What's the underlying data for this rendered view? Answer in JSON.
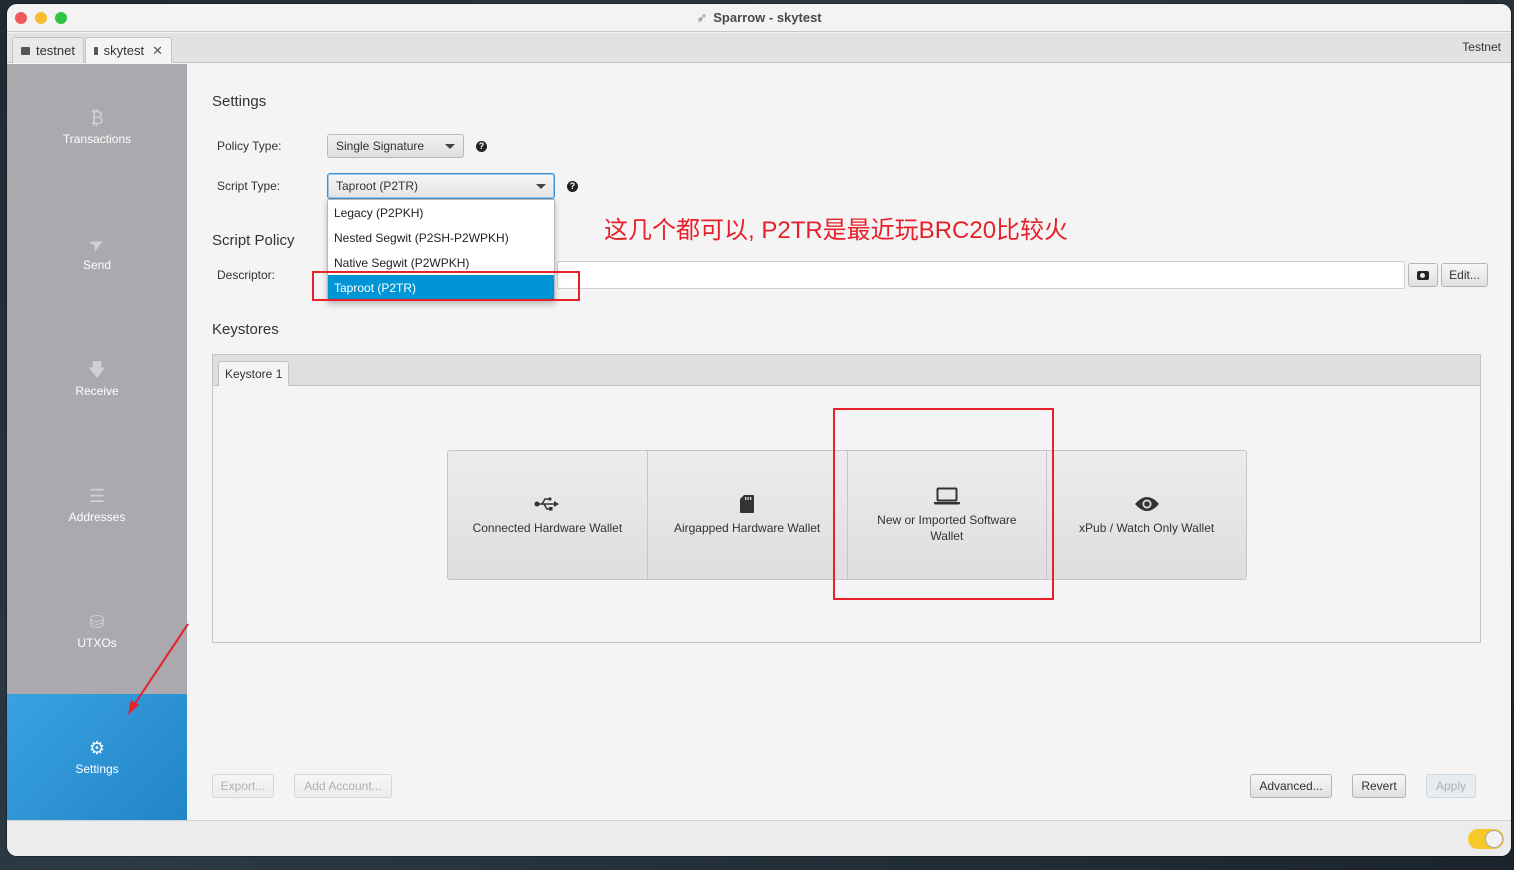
{
  "window": {
    "title": "Sparrow - skytest",
    "app_icon": "sparrow-bird-icon"
  },
  "tabs": [
    {
      "label": "testnet",
      "icon": "wallet-icon",
      "closable": false,
      "active": false
    },
    {
      "label": "skytest",
      "icon": "wallet-icon",
      "closable": true,
      "active": true,
      "close_glyph": "✕"
    }
  ],
  "network": "Testnet",
  "sidebar": {
    "items": [
      {
        "label": "Transactions",
        "icon": "bitcoin-icon",
        "glyph": "₿",
        "active": false
      },
      {
        "label": "Send",
        "icon": "paper-plane-icon",
        "glyph": "➤",
        "active": false
      },
      {
        "label": "Receive",
        "icon": "arrow-down-icon",
        "glyph": "🡇",
        "active": false
      },
      {
        "label": "Addresses",
        "icon": "list-icon",
        "glyph": "☰",
        "active": false
      },
      {
        "label": "UTXOs",
        "icon": "coins-icon",
        "glyph": "⛁",
        "active": false
      },
      {
        "label": "Settings",
        "icon": "gear-icon",
        "glyph": "⚙",
        "active": true
      }
    ]
  },
  "settings": {
    "title": "Settings",
    "policy_type": {
      "label": "Policy Type:",
      "value": "Single Signature"
    },
    "script_type": {
      "label": "Script Type:",
      "value": "Taproot (P2TR)",
      "options": [
        {
          "label": "Legacy (P2PKH)",
          "selected": false
        },
        {
          "label": "Nested Segwit (P2SH-P2WPKH)",
          "selected": false
        },
        {
          "label": "Native Segwit (P2WPKH)",
          "selected": false
        },
        {
          "label": "Taproot (P2TR)",
          "selected": true
        }
      ]
    },
    "help_glyph": "?"
  },
  "script_policy": {
    "title": "Script Policy",
    "descriptor_label": "Descriptor:",
    "descriptor_value": "",
    "edit_label": "Edit...",
    "camera_icon": "camera-icon"
  },
  "keystores": {
    "title": "Keystores",
    "tabs": [
      {
        "label": "Keystore 1"
      }
    ],
    "options": [
      {
        "label": "Connected Hardware Wallet",
        "icon": "usb-icon"
      },
      {
        "label": "Airgapped Hardware Wallet",
        "icon": "sd-card-icon"
      },
      {
        "label": "New or Imported Software Wallet",
        "icon": "laptop-icon"
      },
      {
        "label": "xPub / Watch Only Wallet",
        "icon": "eye-icon"
      }
    ]
  },
  "footer": {
    "export_label": "Export...",
    "add_account_label": "Add Account...",
    "advanced_label": "Advanced...",
    "revert_label": "Revert",
    "apply_label": "Apply"
  },
  "annotation": {
    "text": "这几个都可以, P2TR是最近玩BRC20比较火",
    "color": "#e8202a"
  },
  "colors": {
    "accent": "#2185c8",
    "selection": "#0096d6",
    "toggle": "#f6c928"
  }
}
